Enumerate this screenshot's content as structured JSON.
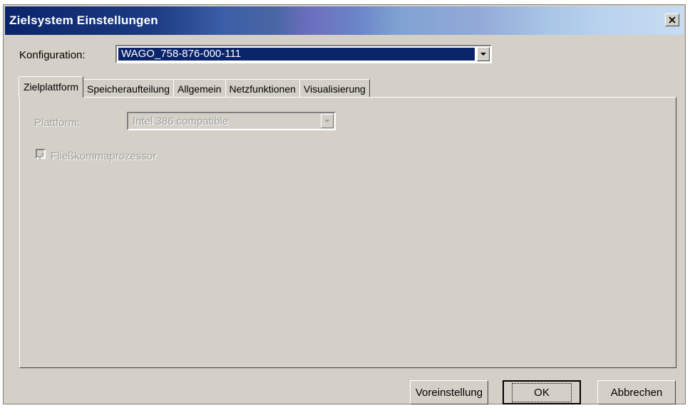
{
  "window": {
    "title": "Zielsystem Einstellungen",
    "close_icon": "close-icon"
  },
  "konfiguration": {
    "label": "Konfiguration:",
    "value": "WAGO_758-876-000-111"
  },
  "tabs": [
    {
      "label": "Zielplattform",
      "active": true
    },
    {
      "label": "Speicheraufteilung",
      "active": false
    },
    {
      "label": "Allgemein",
      "active": false
    },
    {
      "label": "Netzfunktionen",
      "active": false
    },
    {
      "label": "Visualisierung",
      "active": false
    }
  ],
  "zielplattform": {
    "plattform_label": "Plattform:",
    "plattform_value": "Intel 386 compatible",
    "fpu_label": "Fließkommaprozessor",
    "fpu_checked": true,
    "enabled": false
  },
  "buttons": {
    "voreinstellung": "Voreinstellung",
    "ok": "OK",
    "abbrechen": "Abbrechen"
  },
  "colors": {
    "dialog_face": "#d4d0c8",
    "title_dark": "#0a246a",
    "selection": "#0a246a",
    "disabled_text": "#a0a0a0"
  }
}
